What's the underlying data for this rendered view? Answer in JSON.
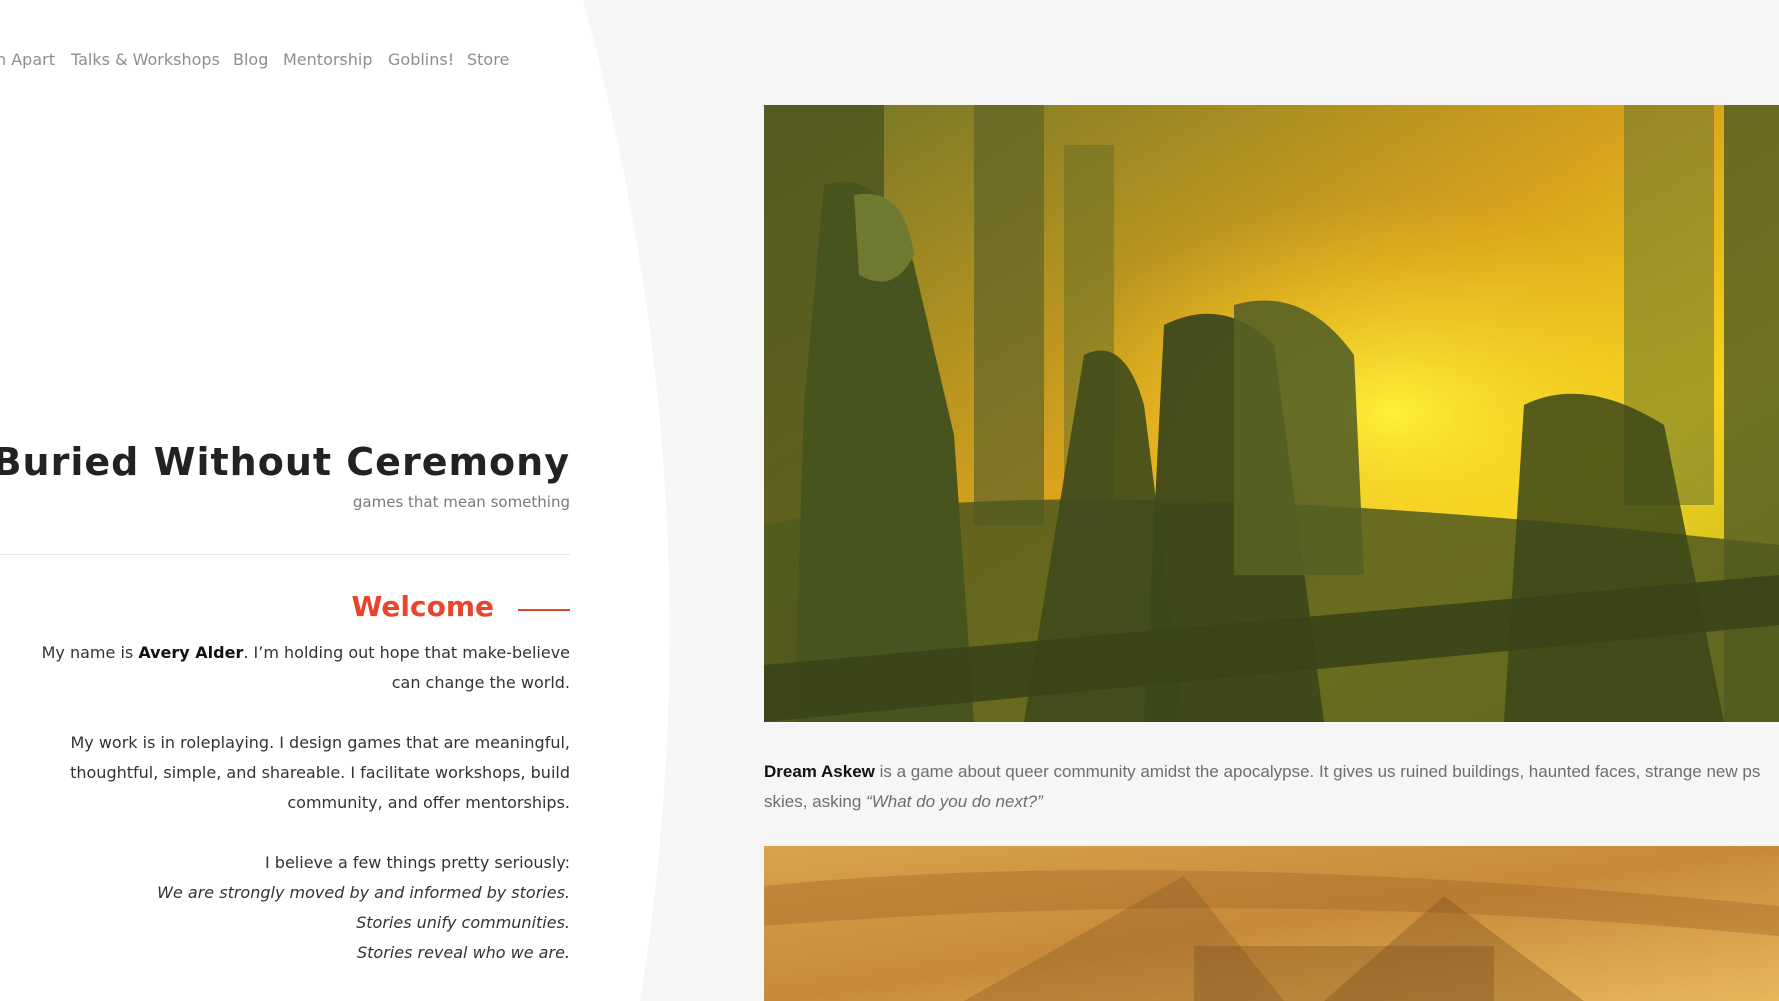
{
  "nav": {
    "items": [
      {
        "label": "n Apart"
      },
      {
        "label": "Talks & Workshops"
      },
      {
        "label": "Blog"
      },
      {
        "label": "Mentorship"
      },
      {
        "label": "Goblins!"
      },
      {
        "label": "Store"
      }
    ]
  },
  "site": {
    "title": "Buried Without Ceremony",
    "tagline": "games that mean something"
  },
  "welcome": {
    "heading": "Welcome",
    "p1_before": "My name is ",
    "p1_name": "Avery Alder",
    "p1_after": ". I’m holding out hope that make-believe can change the world.",
    "p2": "My work is in roleplaying. I design games that are meaningful, thoughtful, simple, and shareable. I facilitate workshops, build community, and offer mentorships.",
    "p3_intro": "I believe a few things pretty seriously:",
    "beliefs": [
      "We are strongly moved by and informed by stories.",
      "Stories unify communities.",
      "Stories reveal who we are."
    ]
  },
  "feature": {
    "game_name": "Dream Askew",
    "caption_text": " is a game about queer community amidst the apocalypse. It gives us ruined buildings, haunted faces, strange new ps",
    "caption_line2_prefix": "skies, asking ",
    "caption_quote": "“What do you do next?”"
  },
  "colors": {
    "accent": "#e8452c",
    "page_bg": "#f6f6f6",
    "panel_bg": "#ffffff"
  }
}
